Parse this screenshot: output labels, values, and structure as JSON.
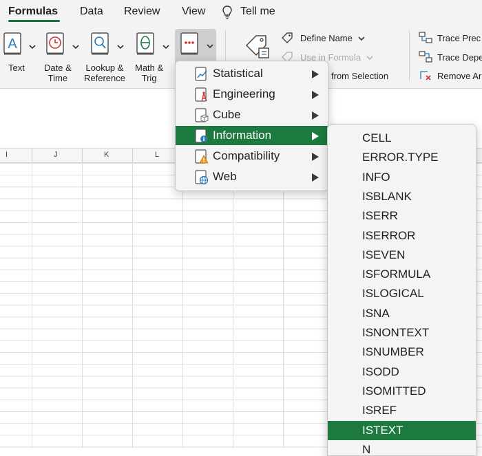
{
  "tabs": [
    {
      "label": "Formulas",
      "active": true
    },
    {
      "label": "Data"
    },
    {
      "label": "Review"
    },
    {
      "label": "View"
    },
    {
      "label": "Tell me"
    }
  ],
  "ribbon": {
    "text_label": "Text",
    "datetime_label_1": "Date &",
    "datetime_label_2": "Time",
    "lookup_label_1": "Lookup &",
    "lookup_label_2": "Reference",
    "math_label_1": "Math &",
    "math_label_2": "Trig",
    "define_name": "Define Name",
    "use_in_formula": "Use in Formula",
    "create_from_selection": "from Selection",
    "trace_precedents": "Trace Prec",
    "trace_dependents": "Trace Depe",
    "remove_arrows": "Remove Ar"
  },
  "columns": [
    "I",
    "J",
    "K",
    "L"
  ],
  "menu": {
    "items": [
      {
        "label": "Statistical",
        "icon": "statistical-book-icon"
      },
      {
        "label": "Engineering",
        "icon": "engineering-book-icon"
      },
      {
        "label": "Cube",
        "icon": "cube-book-icon"
      },
      {
        "label": "Information",
        "icon": "information-book-icon",
        "selected": true
      },
      {
        "label": "Compatibility",
        "icon": "compatibility-book-icon"
      },
      {
        "label": "Web",
        "icon": "web-book-icon"
      }
    ]
  },
  "submenu": {
    "items": [
      "CELL",
      "ERROR.TYPE",
      "INFO",
      "ISBLANK",
      "ISERR",
      "ISERROR",
      "ISEVEN",
      "ISFORMULA",
      "ISLOGICAL",
      "ISNA",
      "ISNONTEXT",
      "ISNUMBER",
      "ISODD",
      "ISOMITTED",
      "ISREF",
      "ISTEXT",
      "N"
    ],
    "selected": "ISTEXT"
  },
  "colors": {
    "accent": "#1d7a3f",
    "tab_underline": "#1d6e3f",
    "error_red": "#d32f2f",
    "icon_blue": "#2a7ab8"
  }
}
